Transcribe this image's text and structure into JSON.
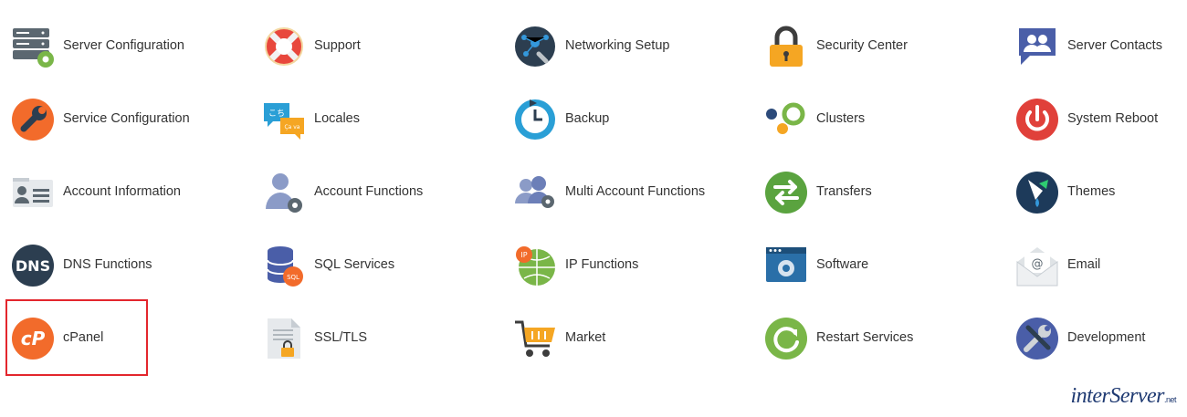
{
  "items": [
    {
      "label": "Server Configuration",
      "icon": "server-gear-icon"
    },
    {
      "label": "Support",
      "icon": "lifebuoy-icon"
    },
    {
      "label": "Networking Setup",
      "icon": "network-wrench-icon"
    },
    {
      "label": "Security Center",
      "icon": "padlock-icon"
    },
    {
      "label": "Server Contacts",
      "icon": "contacts-icon"
    },
    {
      "label": "Service Configuration",
      "icon": "wrench-icon"
    },
    {
      "label": "Locales",
      "icon": "speech-bubbles-icon"
    },
    {
      "label": "Backup",
      "icon": "clock-backup-icon"
    },
    {
      "label": "Clusters",
      "icon": "clusters-icon"
    },
    {
      "label": "System Reboot",
      "icon": "power-icon"
    },
    {
      "label": "Account Information",
      "icon": "id-card-icon"
    },
    {
      "label": "Account Functions",
      "icon": "user-gear-icon"
    },
    {
      "label": "Multi Account Functions",
      "icon": "users-gear-icon"
    },
    {
      "label": "Transfers",
      "icon": "transfer-arrows-icon"
    },
    {
      "label": "Themes",
      "icon": "paint-icon"
    },
    {
      "label": "DNS Functions",
      "icon": "dns-icon"
    },
    {
      "label": "SQL Services",
      "icon": "database-sql-icon"
    },
    {
      "label": "IP Functions",
      "icon": "globe-ip-icon"
    },
    {
      "label": "Software",
      "icon": "software-window-icon"
    },
    {
      "label": "Email",
      "icon": "envelope-icon"
    },
    {
      "label": "cPanel",
      "icon": "cpanel-icon"
    },
    {
      "label": "SSL/TLS",
      "icon": "certificate-lock-icon"
    },
    {
      "label": "Market",
      "icon": "shopping-cart-icon"
    },
    {
      "label": "Restart Services",
      "icon": "restart-icon"
    },
    {
      "label": "Development",
      "icon": "tools-icon"
    }
  ],
  "branding": {
    "logo_text": "interServer",
    "logo_suffix": ".net"
  },
  "colors": {
    "highlight": "#e3262d",
    "text": "#333333",
    "accent_orange": "#f26b2b",
    "accent_blue": "#2c3e50"
  }
}
